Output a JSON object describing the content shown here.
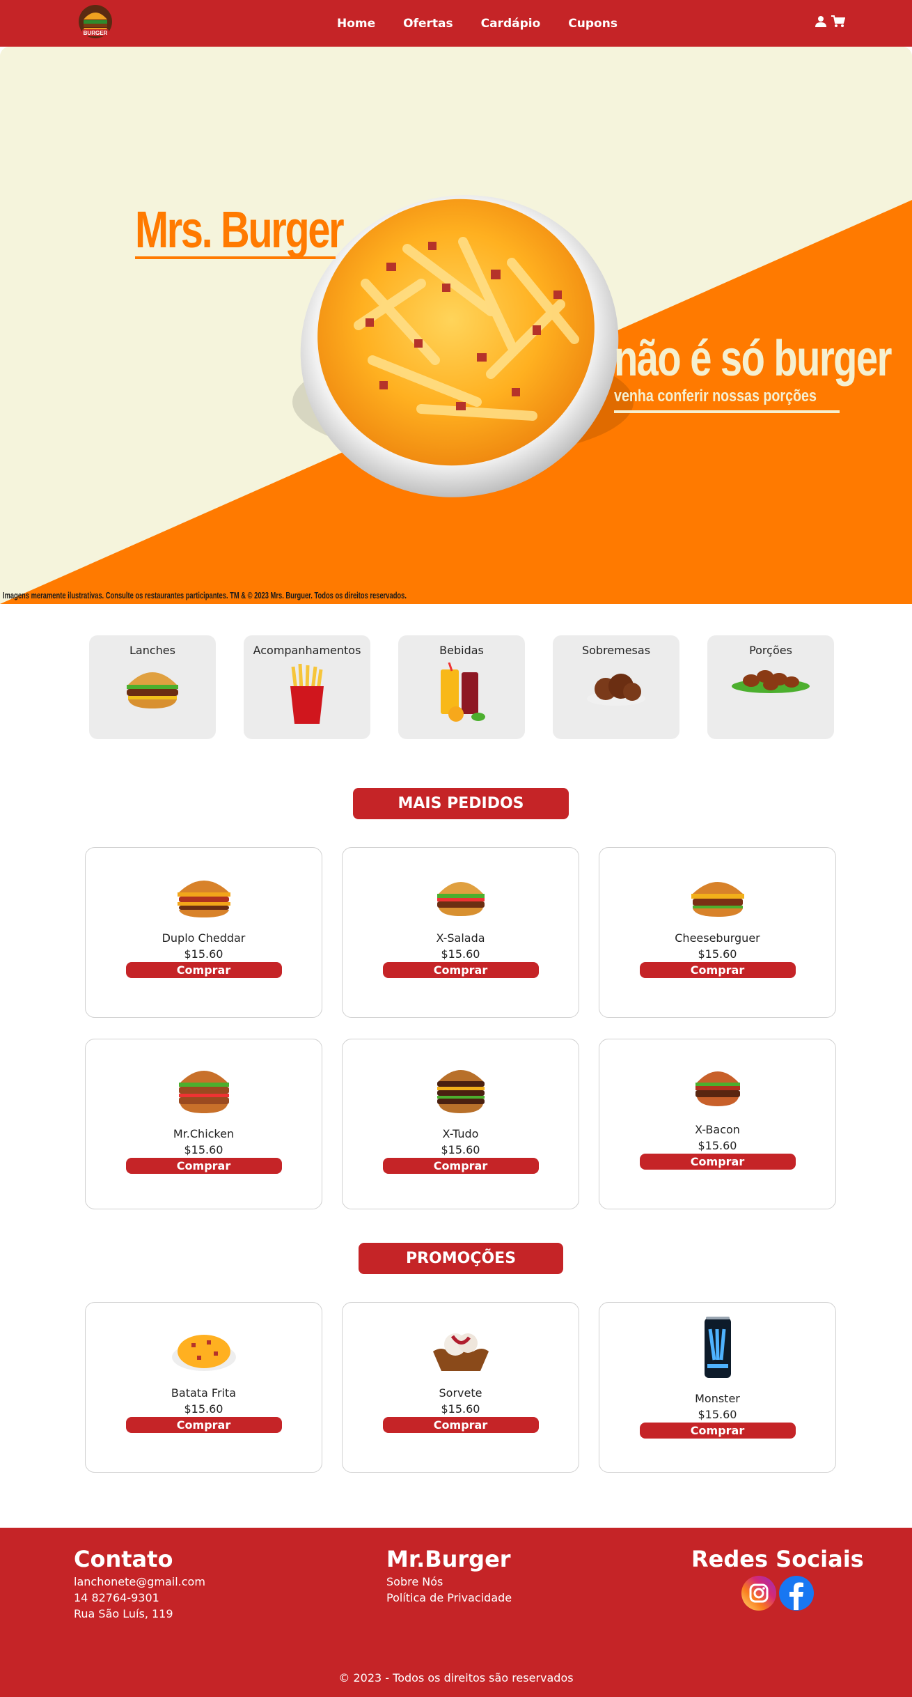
{
  "nav": {
    "links": [
      "Home",
      "Ofertas",
      "Cardápio",
      "Cupons"
    ]
  },
  "hero": {
    "title": "Mrs. Burger",
    "tagline": "não é só burger",
    "subtitle": "venha conferir nossas porções",
    "disclaimer": "Imagens meramente ilustrativas. Consulte os restaurantes participantes. TM & © 2023 Mrs. Burguer. Todos os direitos reservados."
  },
  "categories": [
    "Lanches",
    "Acompanhamentos",
    "Bebidas",
    "Sobremesas",
    "Porções"
  ],
  "mais_pedidos": {
    "title": "MAIS PEDIDOS",
    "items": [
      {
        "name": "Duplo Cheddar",
        "price": "$15.60",
        "button": "Comprar"
      },
      {
        "name": "X-Salada",
        "price": "$15.60",
        "button": "Comprar"
      },
      {
        "name": "Cheeseburguer",
        "price": "$15.60",
        "button": "Comprar"
      },
      {
        "name": "Mr.Chicken",
        "price": "$15.60",
        "button": "Comprar"
      },
      {
        "name": "X-Tudo",
        "price": "$15.60",
        "button": "Comprar"
      },
      {
        "name": "X-Bacon",
        "price": "$15.60",
        "button": "Comprar"
      }
    ]
  },
  "promocoes": {
    "title": "PROMOÇÕES",
    "items": [
      {
        "name": "Batata Frita",
        "price": "$15.60",
        "button": "Comprar"
      },
      {
        "name": "Sorvete",
        "price": "$15.60",
        "button": "Comprar"
      },
      {
        "name": "Monster",
        "price": "$15.60",
        "button": "Comprar"
      }
    ]
  },
  "footer": {
    "contato": {
      "title": "Contato",
      "email": "lanchonete@gmail.com",
      "phone": "14 82764-9301",
      "address": "Rua São Luís, 119"
    },
    "brand": {
      "title": "Mr.Burger",
      "about": "Sobre Nós",
      "privacy": "Política de Privacidade"
    },
    "social": {
      "title": "Redes Sociais",
      "icons": [
        "instagram-icon",
        "facebook-icon"
      ]
    },
    "copyright": "© 2023 - Todos os direitos são reservados"
  },
  "colors": {
    "brand_red": "#c52427",
    "hero_orange": "#ff7a00",
    "hero_cream": "#f5f4dc"
  }
}
